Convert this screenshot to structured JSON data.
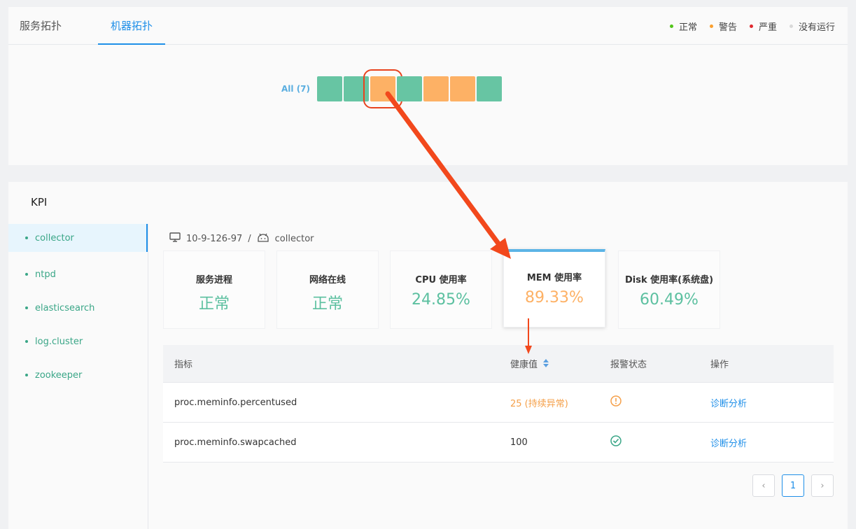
{
  "tabs": [
    {
      "label": "服务拓扑"
    },
    {
      "label": "机器拓扑"
    }
  ],
  "legend": [
    {
      "label": "正常",
      "color": "#52c41a"
    },
    {
      "label": "警告",
      "color": "#fa9f2e"
    },
    {
      "label": "严重",
      "color": "#e0282e"
    },
    {
      "label": "没有运行",
      "color": "#d9d9d9"
    }
  ],
  "topology": {
    "all_label": "All (7)",
    "statuses": [
      "normal",
      "normal",
      "warning",
      "normal",
      "warning",
      "warning",
      "normal"
    ],
    "selected_index": 2
  },
  "kpi": {
    "title": "KPI",
    "services": [
      "collector",
      "ntpd",
      "elasticsearch",
      "log.cluster",
      "zookeeper"
    ],
    "breadcrumb": {
      "host": "10-9-126-97",
      "separator": "/",
      "service": "collector"
    },
    "cards": [
      {
        "title": "服务进程",
        "value": "正常"
      },
      {
        "title": "网络在线",
        "value": "正常"
      },
      {
        "title": "CPU 使用率",
        "value": "24.85%"
      },
      {
        "title": "MEM 使用率",
        "value": "89.33%"
      },
      {
        "title": "Disk 使用率(系统盘)",
        "value": "60.49%"
      }
    ],
    "table": {
      "headers": [
        "指标",
        "健康值",
        "报警状态",
        "操作"
      ],
      "rows": [
        {
          "metric": "proc.meminfo.percentused",
          "health": "25 (持续异常)",
          "status": "warning",
          "action": "诊断分析"
        },
        {
          "metric": "proc.meminfo.swapcached",
          "health": "100",
          "status": "ok",
          "action": "诊断分析"
        }
      ]
    },
    "pagination": {
      "current": "1"
    }
  },
  "colors": {
    "normal": "#67c5a3",
    "warning": "#fdb165",
    "accent": "#1f8fe8",
    "arrow": "#f2481c"
  }
}
